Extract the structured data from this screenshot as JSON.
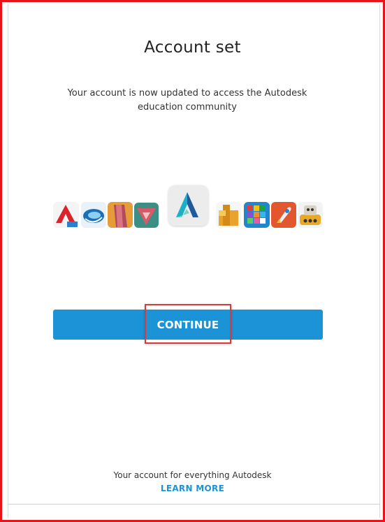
{
  "dialog": {
    "title": "Account set",
    "subtitle": "Your account is now updated to access the Autodesk education community"
  },
  "product_icons": [
    "autocad-icon",
    "alias-icon",
    "revit-icon",
    "inventor-icon",
    "autodesk-logo-icon",
    "maya-icon",
    "tinkercad-icon",
    "launch-rocket-icon",
    "circuits-robot-icon"
  ],
  "actions": {
    "continue_label": "CONTINUE"
  },
  "footer": {
    "tagline": "Your account for everything Autodesk",
    "learn_more": "LEARN MORE"
  },
  "colors": {
    "button": "#1c93d6",
    "link": "#1c93d6",
    "annotation_red": "#e8131b"
  }
}
